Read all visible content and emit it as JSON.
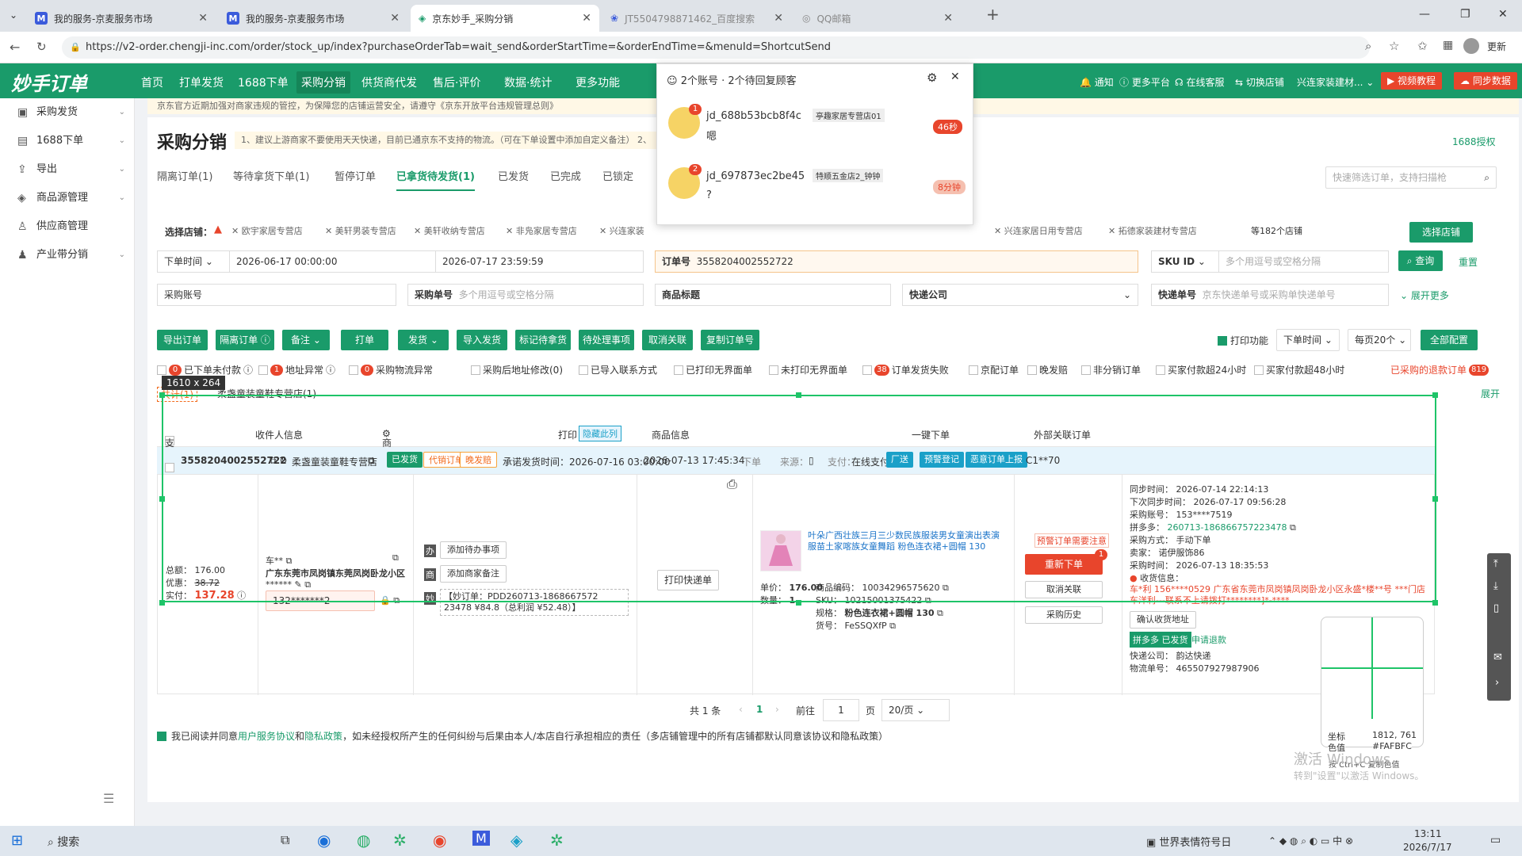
{
  "browser": {
    "tabs": [
      {
        "title": "我的服务-京麦服务市场"
      },
      {
        "title": "我的服务-京麦服务市场"
      },
      {
        "title": "京东妙手_采购分销"
      },
      {
        "title": "JT5504798871462_百度搜索"
      },
      {
        "title": "QQ邮箱"
      }
    ],
    "url": "https://v2-order.chengji-inc.com/order/stock_up/index?purchaseOrderTab=wait_send&orderStartTime=&orderEndTime=&menuId=ShortcutSend",
    "more": "更新"
  },
  "header": {
    "logo": "妙手订单",
    "nav": [
      "首页",
      "打单发货",
      "1688下单",
      "采购分销",
      "供货商代发",
      "售后·评价",
      "数据·统计",
      "更多功能"
    ],
    "right": [
      "通知",
      "更多平台",
      "在线客服",
      "切换店铺",
      "兴连家装建材...",
      "视频教程",
      "同步数据"
    ]
  },
  "sidebar": [
    {
      "label": "采购发货",
      "icon": "box-icon"
    },
    {
      "label": "1688下单",
      "icon": "cart-icon"
    },
    {
      "label": "导出",
      "icon": "export-icon"
    },
    {
      "label": "商品源管理",
      "icon": "cube-icon"
    },
    {
      "label": "供应商管理",
      "icon": "user-icon"
    },
    {
      "label": "产业带分销",
      "icon": "team-icon"
    }
  ],
  "notice": "京东官方近期加强对商家违规的管控，为保障您的店铺运营安全，请遵守《京东开放平台违规管理总则》",
  "page": {
    "title": "采购分销",
    "tip": "1、建议上游商家不要使用天天快递，目前已通京东不支持的物流。（可在下单设置中添加自定义备注） 2、",
    "auth": "1688授权",
    "tabs": [
      "隔离订单(1)",
      "等待拿货下单(1)",
      "暂停订单",
      "已拿货待发货(1)",
      "已发货",
      "已完成",
      "已锁定"
    ],
    "search_ph": "快速筛选订单，支持扫描枪"
  },
  "shops": {
    "label": "选择店铺：",
    "chips": [
      "欧宇家居专营店",
      "美轩男装专营店",
      "美轩收纳专营店",
      "非凫家居专营店",
      "兴连家装",
      "兴连家居日用专营店",
      "拓德家装建材专营店"
    ],
    "count": "等182个店铺",
    "btn": "选择店铺"
  },
  "filters": {
    "time_type": "下单时间",
    "start": "2026-06-17 00:00:00",
    "end": "2026-07-17 23:59:59",
    "order_label": "订单号",
    "order_value": "3558204002552722",
    "sku_label": "SKU ID",
    "sku_ph": "多个用逗号或空格分隔",
    "query": "查询",
    "reset": "重置",
    "purchase_account": "采购账号",
    "purchase_no": "采购单号",
    "purchase_no_ph": "多个用逗号或空格分隔",
    "goods_title": "商品标题",
    "express": "快递公司",
    "express_no": "快递单号",
    "express_no_ph": "京东快递单号或采购单快递单号",
    "more": "展开更多"
  },
  "actions": [
    "导出订单",
    "隔离订单",
    "备注",
    "打单",
    "发货",
    "导入发货",
    "标记待拿货",
    "待处理事项",
    "取消关联",
    "复制订单号"
  ],
  "actions_right": {
    "print": "打印功能",
    "sort": "下单时间",
    "page": "每页20个",
    "config": "全部配置"
  },
  "checks": [
    {
      "t": "已下单未付款",
      "n": "0"
    },
    {
      "t": "地址异常",
      "n": "1"
    },
    {
      "t": "采购物流异常",
      "n": "0"
    },
    {
      "t": "采购后地址修改(0)"
    },
    {
      "t": "已导入联系方式"
    },
    {
      "t": "已打印无界面单"
    },
    {
      "t": "未打印无界面单"
    },
    {
      "t": "订单发货失败",
      "n": "38"
    },
    {
      "t": "京配订单"
    },
    {
      "t": "晚发赔"
    },
    {
      "t": "非分销订单"
    },
    {
      "t": "买家付款超24小时"
    },
    {
      "t": "买家付款超48小时"
    }
  ],
  "checks_right": {
    "t": "已采购的退款订单",
    "n": "819"
  },
  "group": {
    "label": "共计(1)",
    "shop": "柔盏童装童鞋专营店(1)",
    "expand": "展开"
  },
  "size_label": "1610 x 264",
  "table": {
    "headers": [
      "支付金额",
      "收件人信息",
      "商家/本地备注",
      "打印",
      "隐藏此列",
      "商品信息",
      "一键下单",
      "外部关联订单"
    ],
    "order": {
      "id": "3558204002552722",
      "shop": "柔盏童装童鞋专营店",
      "tags": [
        "已发货",
        "代销订单",
        "晚发赔"
      ],
      "promise": "承诺发货时间：2026-07-16 03:00:00",
      "created": "2026-07-13 17:45:34",
      "created_suffix": "下单",
      "source": "来源：",
      "pay": "支付：",
      "pay_method": "在线支付",
      "tags2": [
        "厂送",
        "预警登记",
        "恶意订单上报"
      ],
      "ext": "C1**70"
    },
    "amount": {
      "total_l": "总额：",
      "total": "176.00",
      "discount_l": "优惠：",
      "discount": "38.72",
      "paid_l": "实付：",
      "paid": "137.28"
    },
    "recv": {
      "name": "车**",
      "addr": "广东东莞市凤岗镇东莞凤岗卧龙小区",
      "mask": "******",
      "phone": "132*******2"
    },
    "remark": {
      "todo": "添加待办事项",
      "note": "添加商家备注",
      "miaoshou": "【妙订单：PDD260713-1868667572 23478 ¥84.8（总利润 ¥52.48）】"
    },
    "print": {
      "btn": "打印快递单"
    },
    "goods": {
      "title": "叶朵广西壮族三月三少数民族服装男女童演出表演服苗土家喀族女童舞蹈 粉色连衣裙+圆帽 130",
      "price_l": "单价：",
      "price": "176.00",
      "qty_l": "数量：",
      "qty": "1",
      "code_l": "商品编码：",
      "code": "10034296575620",
      "sku_l": "SKU：",
      "sku": "10215001375422",
      "spec_l": "规格：",
      "spec": "粉色连衣裙+圆帽 130",
      "art_l": "货号：",
      "art": "FeSSQXfP"
    },
    "oneclick": {
      "warn": "预警订单需要注意",
      "reorder": "重新下单",
      "cancel": "取消关联",
      "history": "采购历史",
      "badge": "1"
    },
    "ext": [
      [
        "同步时间：",
        "2026-07-14 22:14:13"
      ],
      [
        "下次同步时间：",
        "2026-07-17 09:56:28"
      ],
      [
        "采购账号：",
        "153****7519"
      ],
      [
        "拼多多：",
        "260713-186866757223478"
      ],
      [
        "采购方式：",
        "手动下单"
      ],
      [
        "卖家：",
        "诺伊服饰86"
      ],
      [
        "采购时间：",
        "2026-07-13 18:35:53"
      ]
    ],
    "ext_recv_l": "收货信息：",
    "ext_recv": "车*利 156****0529 广东省东莞市凤岗镇凤岗卧龙小区永盛*楼**号 ***门店车洋利---联系不上请拨打********]*-****",
    "ext_btn": "确认收货地址",
    "ext_status": "拼多多 已发货",
    "ext_refund": "申请退款",
    "ext_express_l": "快递公司：",
    "ext_express": "韵达快递",
    "ext_no_l": "物流单号：",
    "ext_no": "465507927987906"
  },
  "pager": {
    "total": "共 1 条",
    "page": "1",
    "goto": "前往",
    "input": "1",
    "unit": "页",
    "size": "20/页"
  },
  "agree": {
    "a": "我已阅读并同意",
    "b": "用户服务协议",
    "c": "和",
    "d": "隐私政策",
    "e": "，如未经授权所产生的任何纠纷与后果由本人/本店自行承担相应的责任（多店铺管理中的所有店铺都默认同意该协议和隐私政策）"
  },
  "popup": {
    "title": "2个账号 · 2个待回复顾客",
    "items": [
      {
        "name": "jd_688b53bcb8f4c",
        "shop": "亭趣家居专营店01",
        "msg": "嗯",
        "time": "46秒",
        "badge": "1"
      },
      {
        "name": "jd_697873ec2be45",
        "shop": "特顺五金店2_钟钟",
        "msg": "?",
        "time": "8分钟",
        "badge": "2"
      }
    ]
  },
  "magnifier": {
    "coord_l": "坐标",
    "coord": "1812, 761",
    "color_l": "色值",
    "color": "#FAFBFC",
    "hint": "按 Ctrl+C 复制色值"
  },
  "watermark": [
    "激活 Windows",
    "转到\"设置\"以激活 Windows。"
  ],
  "taskbar": {
    "search": "搜索",
    "weather": "世界表情符号日",
    "time": "13:11",
    "date": "2026/7/17",
    "ime": "中"
  }
}
